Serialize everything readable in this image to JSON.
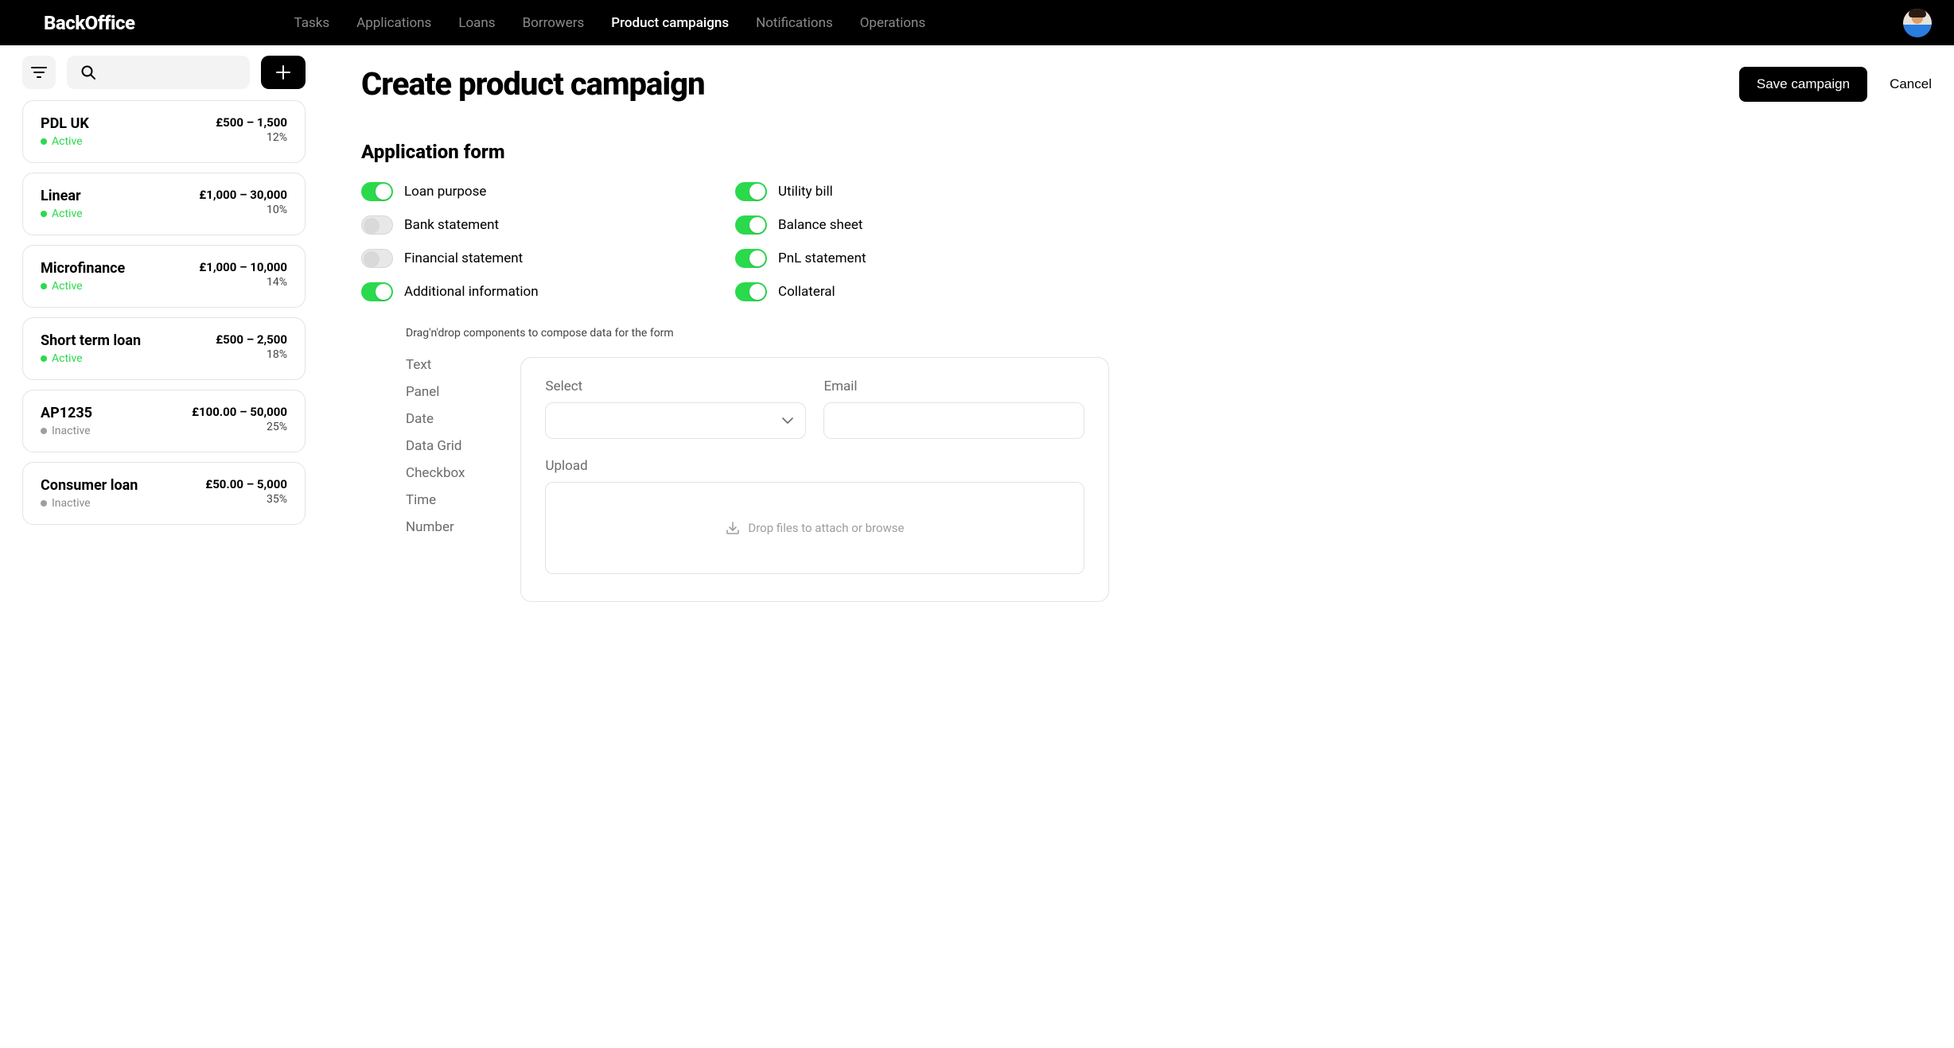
{
  "logo": "BackOffice",
  "nav": {
    "items": [
      {
        "label": "Tasks"
      },
      {
        "label": "Applications"
      },
      {
        "label": "Loans"
      },
      {
        "label": "Borrowers"
      },
      {
        "label": "Product campaigns",
        "active": true
      },
      {
        "label": "Notifications"
      },
      {
        "label": "Operations"
      }
    ]
  },
  "sidebar": {
    "cards": [
      {
        "title": "PDL UK",
        "status": "Active",
        "range": "£500 – 1,500",
        "pct": "12%"
      },
      {
        "title": "Linear",
        "status": "Active",
        "range": "£1,000 – 30,000",
        "pct": "10%"
      },
      {
        "title": "Microfinance",
        "status": "Active",
        "range": "£1,000 – 10,000",
        "pct": "14%"
      },
      {
        "title": "Short term loan",
        "status": "Active",
        "range": "£500 – 2,500",
        "pct": "18%"
      },
      {
        "title": "AP1235",
        "status": "Inactive",
        "range": "£100.00 – 50,000",
        "pct": "25%"
      },
      {
        "title": "Consumer loan",
        "status": "Inactive",
        "range": "£50.00 – 5,000",
        "pct": "35%"
      }
    ]
  },
  "page": {
    "title": "Create product campaign",
    "save_label": "Save campaign",
    "cancel_label": "Cancel"
  },
  "form": {
    "section_title": "Application form",
    "toggles_left": [
      {
        "label": "Loan purpose",
        "on": true
      },
      {
        "label": "Bank statement",
        "on": false
      },
      {
        "label": "Financial statement",
        "on": false
      },
      {
        "label": "Additional information",
        "on": true
      }
    ],
    "toggles_right": [
      {
        "label": "Utility bill",
        "on": true
      },
      {
        "label": "Balance sheet",
        "on": true
      },
      {
        "label": "PnL statement",
        "on": true
      },
      {
        "label": "Collateral",
        "on": true
      }
    ],
    "builder_hint": "Drag'n'drop components to compose data for the form",
    "palette": [
      "Text",
      "Panel",
      "Date",
      "Data Grid",
      "Checkbox",
      "Time",
      "Number"
    ],
    "canvas": {
      "select_label": "Select",
      "email_label": "Email",
      "upload_label": "Upload",
      "dropzone_text": "Drop files to attach or browse"
    }
  }
}
